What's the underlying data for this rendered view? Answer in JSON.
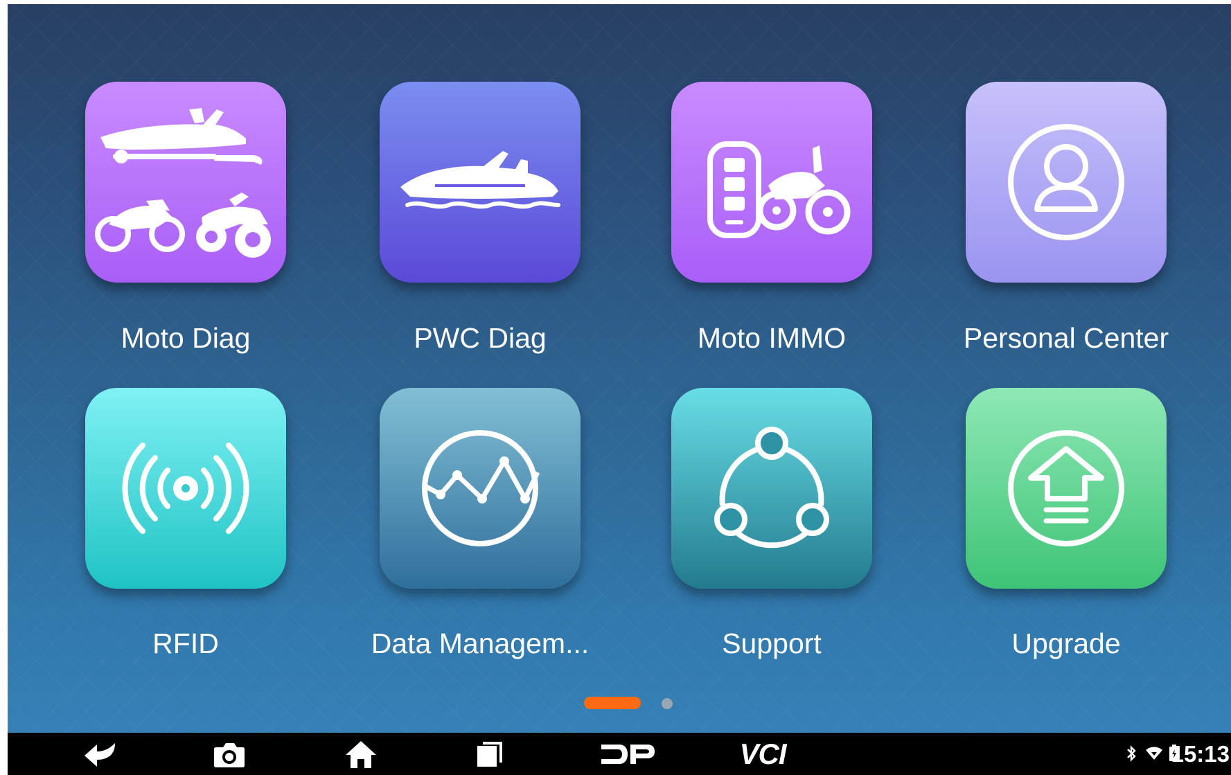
{
  "apps": [
    {
      "id": "moto",
      "label": "Moto Diag"
    },
    {
      "id": "pwc",
      "label": "PWC Diag"
    },
    {
      "id": "immo",
      "label": "Moto IMMO"
    },
    {
      "id": "person",
      "label": "Personal Center"
    },
    {
      "id": "rfid",
      "label": "RFID"
    },
    {
      "id": "data",
      "label": "Data Managem..."
    },
    {
      "id": "support",
      "label": "Support"
    },
    {
      "id": "upgrade",
      "label": "Upgrade"
    }
  ],
  "pager": {
    "total": 2,
    "active": 1
  },
  "navbar": {
    "back_icon": "back-arrow-icon",
    "screenshot_icon": "camera-icon",
    "home_icon": "home-icon",
    "recent_icon": "recent-apps-icon",
    "dp_label": "DP",
    "vci_label": "VCI"
  },
  "status": {
    "time": "15:13",
    "icons": [
      "bluetooth-icon",
      "wifi-icon",
      "battery-icon"
    ]
  },
  "colors": {
    "accent": "#ff6a13",
    "navbar": "#000000"
  }
}
